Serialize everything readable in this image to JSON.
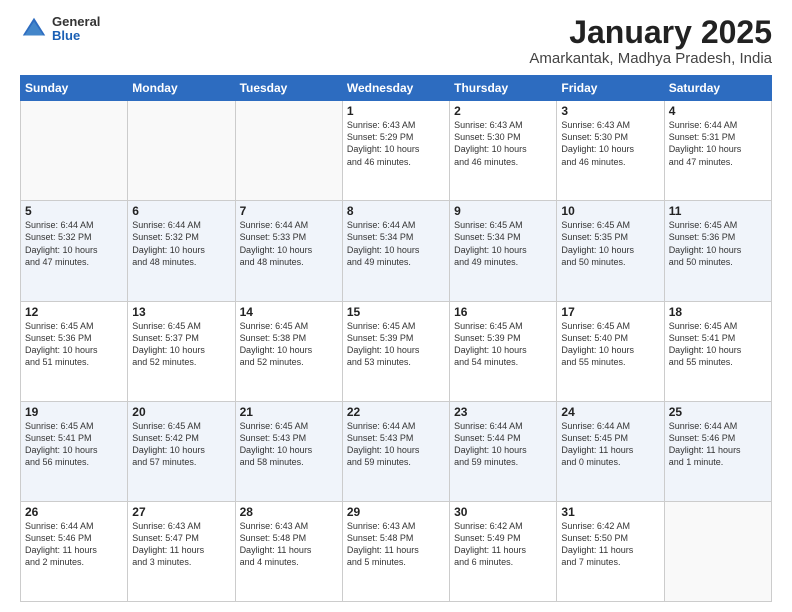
{
  "header": {
    "logo_general": "General",
    "logo_blue": "Blue",
    "title": "January 2025",
    "location": "Amarkantak, Madhya Pradesh, India"
  },
  "days_of_week": [
    "Sunday",
    "Monday",
    "Tuesday",
    "Wednesday",
    "Thursday",
    "Friday",
    "Saturday"
  ],
  "weeks": [
    [
      {
        "day": "",
        "info": ""
      },
      {
        "day": "",
        "info": ""
      },
      {
        "day": "",
        "info": ""
      },
      {
        "day": "1",
        "info": "Sunrise: 6:43 AM\nSunset: 5:29 PM\nDaylight: 10 hours\nand 46 minutes."
      },
      {
        "day": "2",
        "info": "Sunrise: 6:43 AM\nSunset: 5:30 PM\nDaylight: 10 hours\nand 46 minutes."
      },
      {
        "day": "3",
        "info": "Sunrise: 6:43 AM\nSunset: 5:30 PM\nDaylight: 10 hours\nand 46 minutes."
      },
      {
        "day": "4",
        "info": "Sunrise: 6:44 AM\nSunset: 5:31 PM\nDaylight: 10 hours\nand 47 minutes."
      }
    ],
    [
      {
        "day": "5",
        "info": "Sunrise: 6:44 AM\nSunset: 5:32 PM\nDaylight: 10 hours\nand 47 minutes."
      },
      {
        "day": "6",
        "info": "Sunrise: 6:44 AM\nSunset: 5:32 PM\nDaylight: 10 hours\nand 48 minutes."
      },
      {
        "day": "7",
        "info": "Sunrise: 6:44 AM\nSunset: 5:33 PM\nDaylight: 10 hours\nand 48 minutes."
      },
      {
        "day": "8",
        "info": "Sunrise: 6:44 AM\nSunset: 5:34 PM\nDaylight: 10 hours\nand 49 minutes."
      },
      {
        "day": "9",
        "info": "Sunrise: 6:45 AM\nSunset: 5:34 PM\nDaylight: 10 hours\nand 49 minutes."
      },
      {
        "day": "10",
        "info": "Sunrise: 6:45 AM\nSunset: 5:35 PM\nDaylight: 10 hours\nand 50 minutes."
      },
      {
        "day": "11",
        "info": "Sunrise: 6:45 AM\nSunset: 5:36 PM\nDaylight: 10 hours\nand 50 minutes."
      }
    ],
    [
      {
        "day": "12",
        "info": "Sunrise: 6:45 AM\nSunset: 5:36 PM\nDaylight: 10 hours\nand 51 minutes."
      },
      {
        "day": "13",
        "info": "Sunrise: 6:45 AM\nSunset: 5:37 PM\nDaylight: 10 hours\nand 52 minutes."
      },
      {
        "day": "14",
        "info": "Sunrise: 6:45 AM\nSunset: 5:38 PM\nDaylight: 10 hours\nand 52 minutes."
      },
      {
        "day": "15",
        "info": "Sunrise: 6:45 AM\nSunset: 5:39 PM\nDaylight: 10 hours\nand 53 minutes."
      },
      {
        "day": "16",
        "info": "Sunrise: 6:45 AM\nSunset: 5:39 PM\nDaylight: 10 hours\nand 54 minutes."
      },
      {
        "day": "17",
        "info": "Sunrise: 6:45 AM\nSunset: 5:40 PM\nDaylight: 10 hours\nand 55 minutes."
      },
      {
        "day": "18",
        "info": "Sunrise: 6:45 AM\nSunset: 5:41 PM\nDaylight: 10 hours\nand 55 minutes."
      }
    ],
    [
      {
        "day": "19",
        "info": "Sunrise: 6:45 AM\nSunset: 5:41 PM\nDaylight: 10 hours\nand 56 minutes."
      },
      {
        "day": "20",
        "info": "Sunrise: 6:45 AM\nSunset: 5:42 PM\nDaylight: 10 hours\nand 57 minutes."
      },
      {
        "day": "21",
        "info": "Sunrise: 6:45 AM\nSunset: 5:43 PM\nDaylight: 10 hours\nand 58 minutes."
      },
      {
        "day": "22",
        "info": "Sunrise: 6:44 AM\nSunset: 5:43 PM\nDaylight: 10 hours\nand 59 minutes."
      },
      {
        "day": "23",
        "info": "Sunrise: 6:44 AM\nSunset: 5:44 PM\nDaylight: 10 hours\nand 59 minutes."
      },
      {
        "day": "24",
        "info": "Sunrise: 6:44 AM\nSunset: 5:45 PM\nDaylight: 11 hours\nand 0 minutes."
      },
      {
        "day": "25",
        "info": "Sunrise: 6:44 AM\nSunset: 5:46 PM\nDaylight: 11 hours\nand 1 minute."
      }
    ],
    [
      {
        "day": "26",
        "info": "Sunrise: 6:44 AM\nSunset: 5:46 PM\nDaylight: 11 hours\nand 2 minutes."
      },
      {
        "day": "27",
        "info": "Sunrise: 6:43 AM\nSunset: 5:47 PM\nDaylight: 11 hours\nand 3 minutes."
      },
      {
        "day": "28",
        "info": "Sunrise: 6:43 AM\nSunset: 5:48 PM\nDaylight: 11 hours\nand 4 minutes."
      },
      {
        "day": "29",
        "info": "Sunrise: 6:43 AM\nSunset: 5:48 PM\nDaylight: 11 hours\nand 5 minutes."
      },
      {
        "day": "30",
        "info": "Sunrise: 6:42 AM\nSunset: 5:49 PM\nDaylight: 11 hours\nand 6 minutes."
      },
      {
        "day": "31",
        "info": "Sunrise: 6:42 AM\nSunset: 5:50 PM\nDaylight: 11 hours\nand 7 minutes."
      },
      {
        "day": "",
        "info": ""
      }
    ]
  ]
}
